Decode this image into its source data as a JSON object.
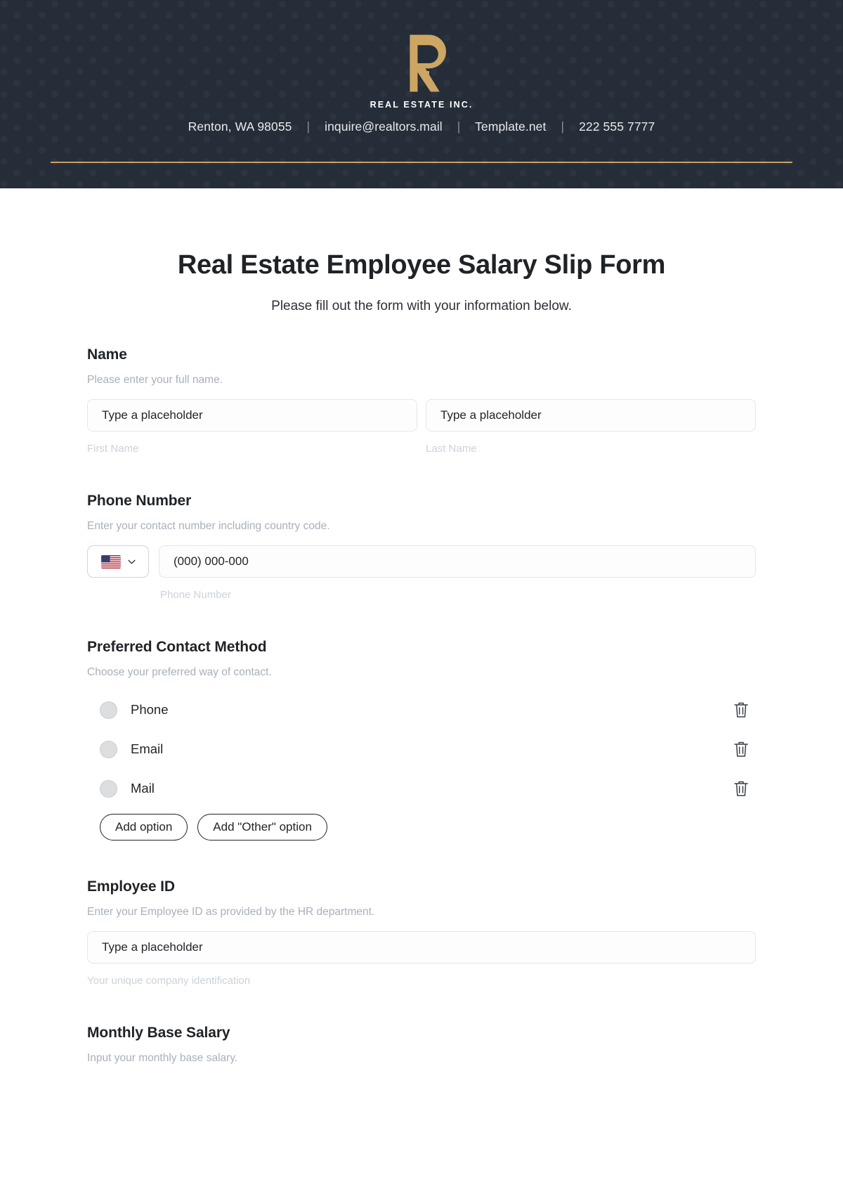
{
  "header": {
    "logo_word": "REAL ESTATE INC.",
    "contact": {
      "address": "Renton, WA 98055",
      "email": "inquire@realtors.mail",
      "website": "Template.net",
      "phone": "222 555 7777",
      "separator": "|"
    },
    "accent_color": "#c9a063",
    "background_color": "#252d38"
  },
  "form": {
    "title": "Real Estate Employee Salary Slip Form",
    "subtitle": "Please fill out the form with your information below.",
    "name": {
      "label": "Name",
      "help": "Please enter your full name.",
      "first_placeholder": "Type a placeholder",
      "last_placeholder": "Type a placeholder",
      "first_sub": "First Name",
      "last_sub": "Last Name"
    },
    "phone": {
      "label": "Phone Number",
      "help": "Enter your contact number including country code.",
      "country": "US",
      "placeholder": "(000) 000-000",
      "sub": "Phone Number"
    },
    "contact_method": {
      "label": "Preferred Contact Method",
      "help": "Choose your preferred way of contact.",
      "options": [
        "Phone",
        "Email",
        "Mail"
      ],
      "add_option": "Add option",
      "add_other_option": "Add \"Other\" option"
    },
    "employee_id": {
      "label": "Employee ID",
      "help": "Enter your Employee ID as provided by the HR department.",
      "placeholder": "Type a placeholder",
      "sub": "Your unique company identification"
    },
    "salary": {
      "label": "Monthly Base Salary",
      "help": "Input your monthly base salary."
    }
  }
}
